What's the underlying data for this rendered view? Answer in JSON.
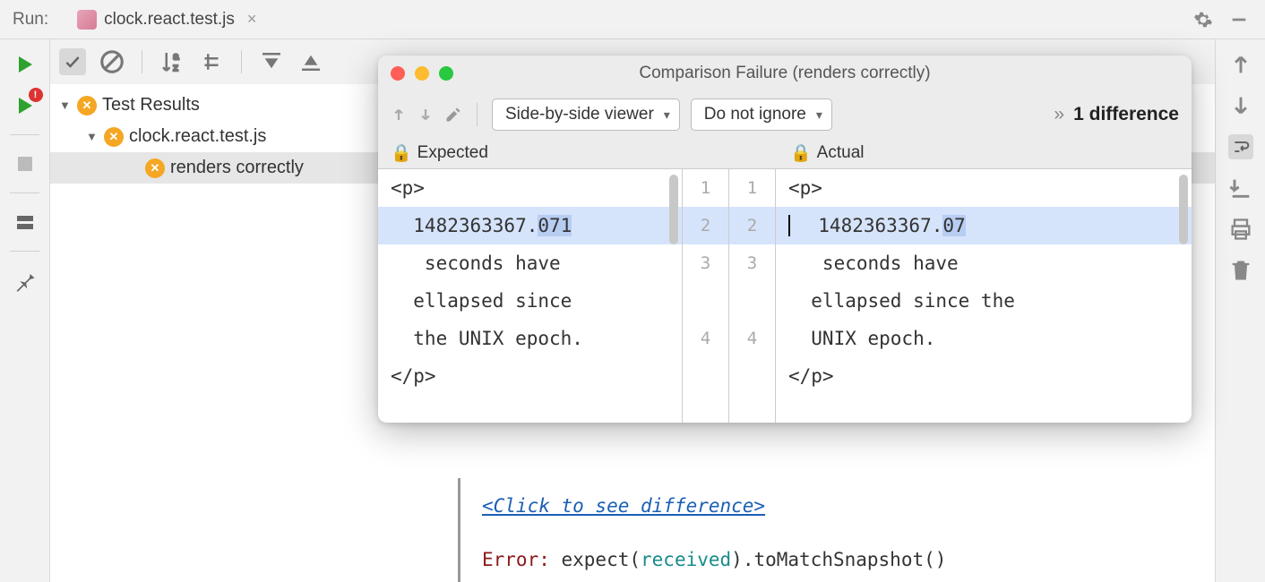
{
  "top": {
    "run_label": "Run:",
    "tab_name": "clock.react.test.js"
  },
  "tree": {
    "root": "Test Results",
    "suite": "clock.react.test.js",
    "test": "renders correctly"
  },
  "console": {
    "diff_link": "<Click to see difference>",
    "error_prefix": "Error:",
    "error_pre": " expect(",
    "error_received": "received",
    "error_post": ").toMatchSnapshot()"
  },
  "dialog": {
    "title": "Comparison Failure (renders correctly)",
    "viewer_mode": "Side-by-side viewer",
    "ignore_mode": "Do not ignore",
    "diff_count": "1 difference",
    "expected_label": "Expected",
    "actual_label": "Actual",
    "gutter_left": [
      "1",
      "2",
      "3",
      "",
      "4"
    ],
    "gutter_right": [
      "1",
      "2",
      "3",
      "",
      "4"
    ],
    "expected_lines": {
      "l1": "<p>",
      "l2_pre": "  1482363367.",
      "l2_hl": "071",
      "l3": "   seconds have",
      "l4": "  ellapsed since",
      "l5": "  the UNIX epoch.",
      "l6": "</p>"
    },
    "actual_lines": {
      "l1": "<p>",
      "l2_pre": "  1482363367.",
      "l2_hl": "07",
      "l3": "   seconds have",
      "l4": "  ellapsed since the",
      "l5": "  UNIX epoch.",
      "l6": "</p>"
    }
  }
}
